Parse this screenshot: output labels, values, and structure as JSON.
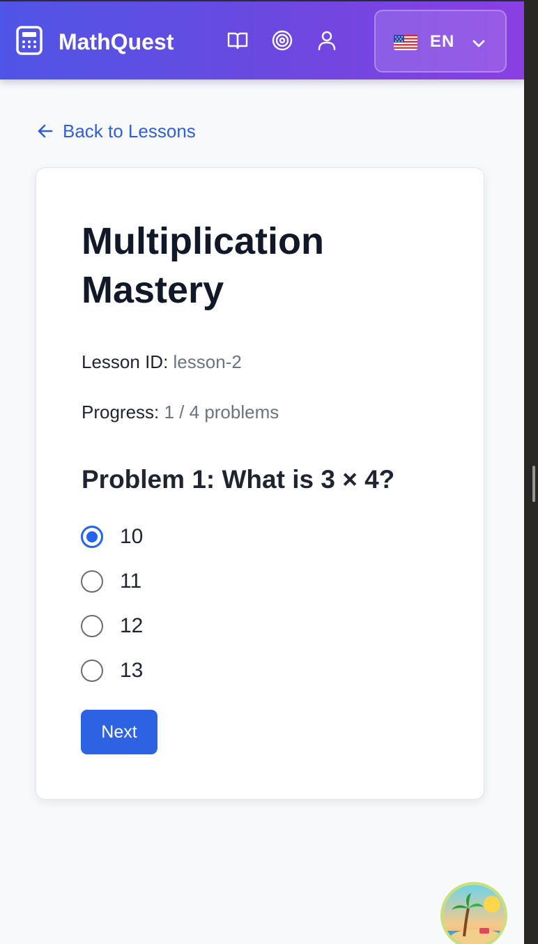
{
  "header": {
    "brand": "MathQuest",
    "nav_icons": [
      "book-icon",
      "target-icon",
      "user-icon"
    ],
    "language": {
      "flag": "us-flag",
      "code": "EN"
    },
    "gradient": [
      "#4f55e6",
      "#8a3fe2"
    ]
  },
  "back_link": {
    "label": "Back to Lessons"
  },
  "lesson": {
    "title": "Multiplication Mastery",
    "id_label": "Lesson ID:",
    "id_value": "lesson-2",
    "progress_label": "Progress:",
    "progress_value": "1 / 4 problems",
    "progress_current": 1,
    "progress_total": 4
  },
  "problem": {
    "title": "Problem 1: What is 3 × 4?",
    "options": [
      {
        "label": "10",
        "selected": true
      },
      {
        "label": "11",
        "selected": false
      },
      {
        "label": "12",
        "selected": false
      },
      {
        "label": "13",
        "selected": false
      }
    ],
    "next_label": "Next"
  },
  "colors": {
    "accent": "#2d63e2",
    "link": "#2f5fd6",
    "title": "#111827",
    "muted": "#6b7280"
  }
}
